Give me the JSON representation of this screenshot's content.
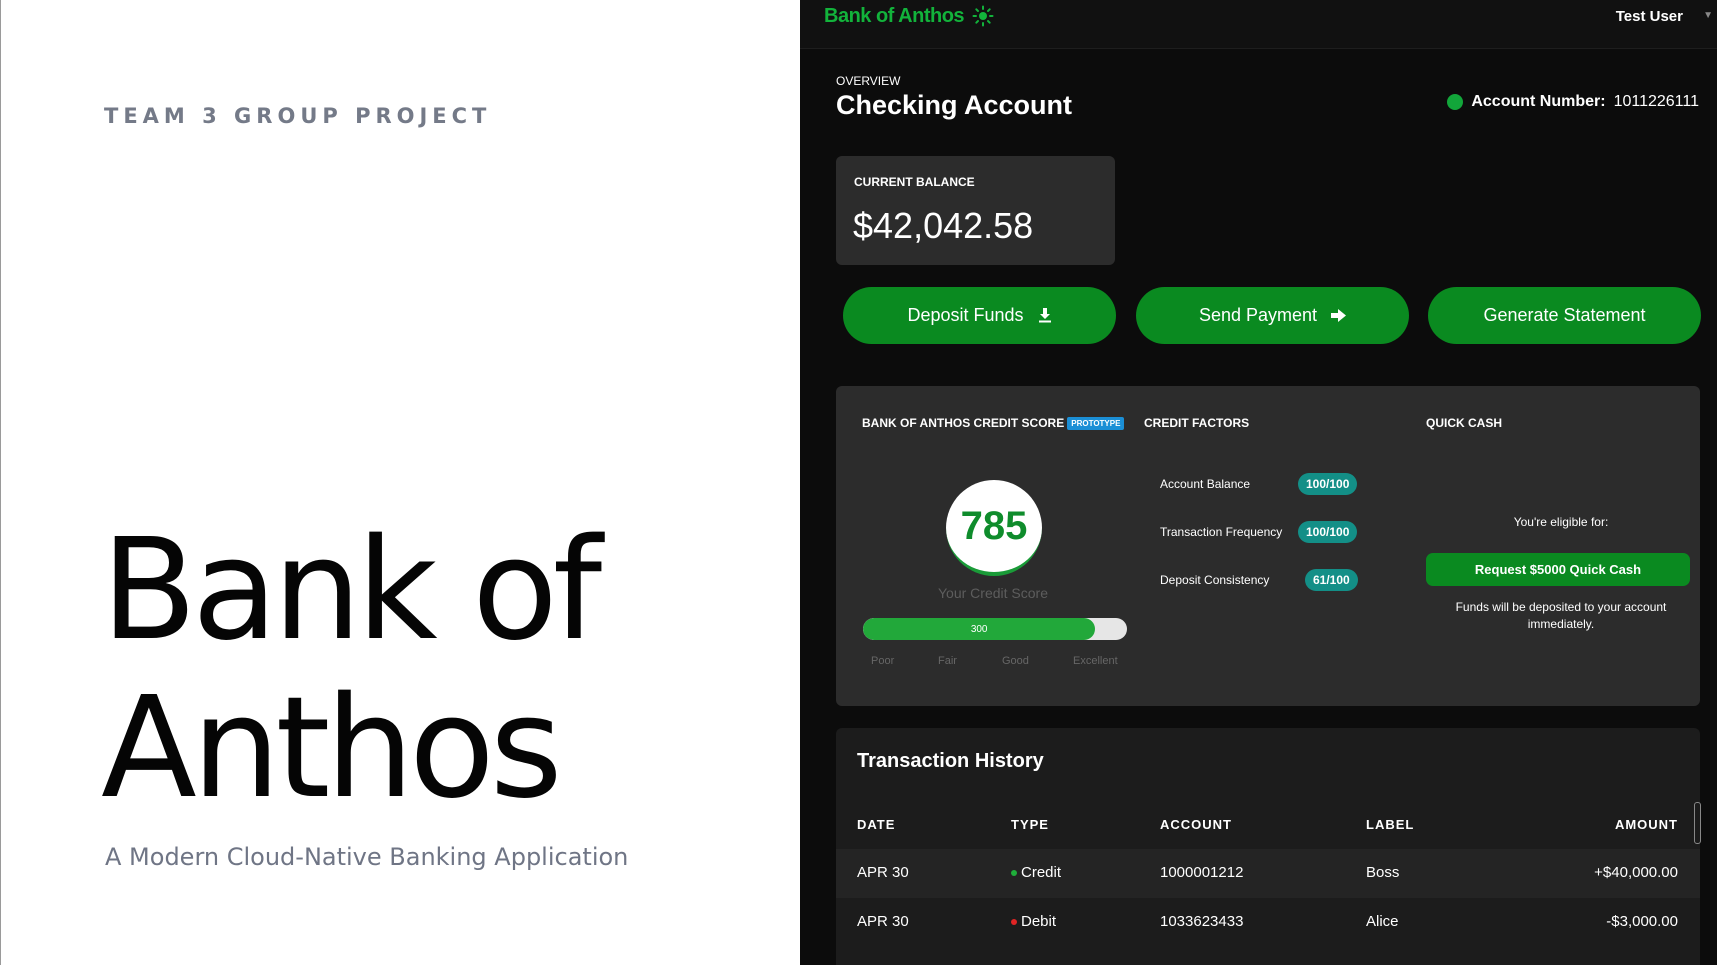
{
  "slide": {
    "eyebrow": "TEAM 3 GROUP PROJECT",
    "title_line1": "Bank of",
    "title_line2": "Anthos",
    "subtitle": "A Modern Cloud-Native Banking Application"
  },
  "header": {
    "brand": "Bank of Anthos",
    "theme_icon": "sun-icon",
    "user": "Test User"
  },
  "overview": {
    "label": "OVERVIEW",
    "title": "Checking Account",
    "account_number_label": "Account Number:",
    "account_number": "1011226111"
  },
  "balance": {
    "label": "CURRENT BALANCE",
    "value": "$42,042.58"
  },
  "actions": {
    "deposit": "Deposit Funds",
    "send": "Send Payment",
    "statement": "Generate Statement"
  },
  "credit": {
    "title": "BANK OF ANTHOS CREDIT SCORE",
    "badge": "PROTOTYPE",
    "score": "785",
    "caption": "Your Credit Score",
    "bar_label": "300",
    "bar_fill_fraction": 0.88,
    "scale": [
      "Poor",
      "Fair",
      "Good",
      "Excellent"
    ]
  },
  "factors": {
    "title": "CREDIT FACTORS",
    "items": [
      {
        "label": "Account Balance",
        "value": "100/100"
      },
      {
        "label": "Transaction Frequency",
        "value": "100/100"
      },
      {
        "label": "Deposit Consistency",
        "value": "61/100"
      }
    ]
  },
  "quick_cash": {
    "title": "QUICK CASH",
    "eligible": "You're eligible for:",
    "button": "Request $5000 Quick Cash",
    "note_line1": "Funds will be deposited to your account",
    "note_line2": "immediately."
  },
  "transactions": {
    "title": "Transaction History",
    "columns": [
      "DATE",
      "TYPE",
      "ACCOUNT",
      "LABEL",
      "AMOUNT"
    ],
    "rows": [
      {
        "date": "APR 30",
        "type": "Credit",
        "account": "1000001212",
        "label": "Boss",
        "amount": "+$40,000.00"
      },
      {
        "date": "APR 30",
        "type": "Debit",
        "account": "1033623433",
        "label": "Alice",
        "amount": "-$3,000.00"
      }
    ]
  },
  "colors": {
    "brand_green": "#12b33b",
    "button_green": "#0a8a20",
    "factor_pill": "#138f87",
    "credit_dot": "#1fae3a",
    "debit_dot": "#e02424"
  }
}
